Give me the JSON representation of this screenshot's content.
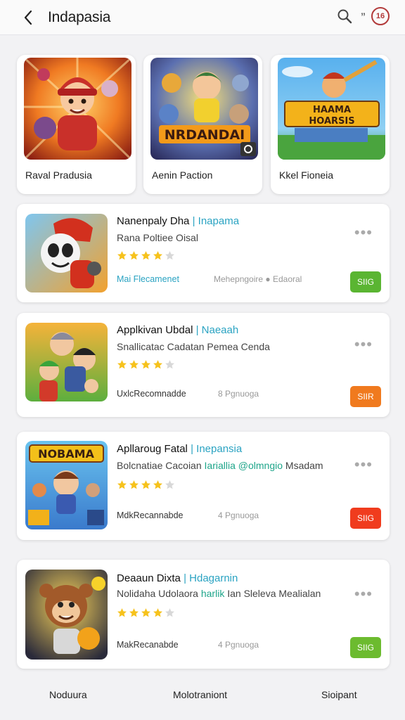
{
  "header": {
    "title": "Indapasia",
    "quote_mark": "”",
    "badge_text": "16"
  },
  "featured": [
    {
      "label": "Raval Pradusia",
      "icon": "hero-art"
    },
    {
      "label": "Aenin Paction",
      "icon": "team-art"
    },
    {
      "label": "Kkel Fioneia",
      "icon": "castle-art"
    }
  ],
  "apps": [
    {
      "name": "Nanenpaly Dha",
      "tag": "Inapama",
      "desc": "Rana Poltiee Oisal",
      "desc_highlight": "",
      "desc_tail": "",
      "rating": 4,
      "meta1": "Mai Flecamenet",
      "meta2": "Mehepngoire ● Edaoral",
      "install_label": "SIIG",
      "install_color": "#5ab532"
    },
    {
      "name": "Applkivan Ubdal",
      "tag": "Naeaah",
      "desc": "Snallicatac Cadatan Pemea Cenda",
      "desc_highlight": "",
      "desc_tail": "",
      "rating": 4,
      "meta1": "UxlcRecomnadde",
      "meta2": "8 Pgnuoga",
      "install_label": "SIIR",
      "install_color": "#f07a1e"
    },
    {
      "name": "Apllaroug Fatal",
      "tag": "Inepansia",
      "desc": "Bolcnatiae Cacoian",
      "desc_highlight": "Iariallia @olmngio",
      "desc_tail": "Msadam",
      "rating": 4,
      "meta1": "MdkRecannabde",
      "meta2": "4 Pgnuoga",
      "install_label": "SIIG",
      "install_color": "#f03c1e"
    },
    {
      "name": "Deaaun Dixta",
      "tag": "Hdagarnin",
      "desc": "Nolidaha Udolaora",
      "desc_highlight": "harlik",
      "desc_tail": "Ian Sleleva Mealialan",
      "rating": 4,
      "meta1": "MakRecanabde",
      "meta2": "4 Pgnuoga",
      "install_label": "SIIG",
      "install_color": "#6cbb2f"
    }
  ],
  "bottom_nav": [
    {
      "label": "Noduura"
    },
    {
      "label": "Molotraniont"
    },
    {
      "label": "Sioipant"
    }
  ]
}
